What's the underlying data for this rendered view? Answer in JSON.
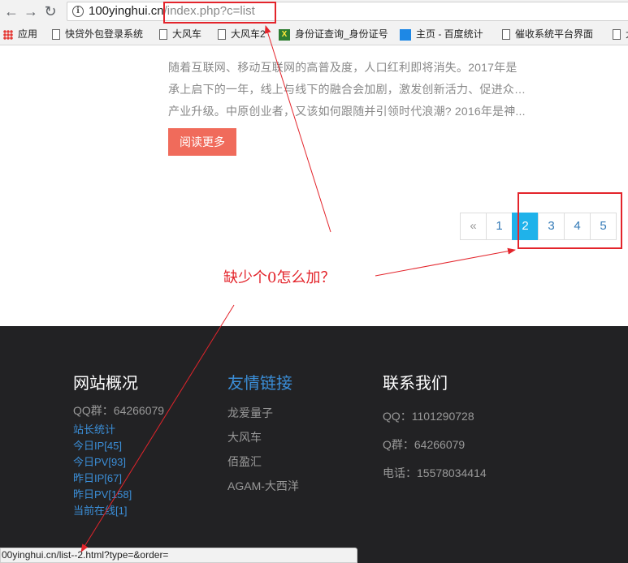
{
  "browser": {
    "url_host": "100yinghui.cn",
    "url_path": "/index.php?c=list",
    "bookmarks": [
      {
        "label": "应用",
        "icon": "apps-icon"
      },
      {
        "label": "快贷外包登录系统",
        "icon": "page-icon"
      },
      {
        "label": "大风车",
        "icon": "page-icon"
      },
      {
        "label": "大风车2",
        "icon": "page-icon"
      },
      {
        "label": "身份证查询_身份证号",
        "icon": "id-card-icon"
      },
      {
        "label": "主页 - 百度统计",
        "icon": "chart-icon"
      },
      {
        "label": "催收系统平台界面",
        "icon": "page-icon"
      },
      {
        "label": "大",
        "icon": "page-icon"
      }
    ]
  },
  "article": {
    "excerpt_lines": [
      "随着互联网、移动互联网的高普及度，人口红利即将消失。2017年是",
      "承上启下的一年，线上与线下的融合会加剧，激发创新活力、促进众多",
      "产业升级。中原创业者，又该如何跟随并引领时代浪潮? 2016年是神..."
    ],
    "read_more": "阅读更多"
  },
  "pagination": {
    "prev": "«",
    "pages": [
      "1",
      "2",
      "3",
      "4",
      "5"
    ],
    "active_page": "2"
  },
  "annotation": {
    "text": "缺少个0怎么加？",
    "color": "#e3242b"
  },
  "footer": {
    "col1": {
      "title": "网站概况",
      "qq_group": "QQ群：64266079",
      "stats": [
        "站长统计",
        "今日IP[45]",
        "今日PV[93]",
        "昨日IP[67]",
        "昨日PV[158]",
        "当前在线[1]"
      ]
    },
    "col2": {
      "title": "友情链接",
      "links": [
        "龙爱量子",
        "大风车",
        "佰盈汇",
        "AGAM-大西洋"
      ]
    },
    "col3": {
      "title": "联系我们",
      "contact": [
        "QQ：1101290728",
        "Q群：64266079",
        "电话：15578034414"
      ]
    }
  },
  "status_bar": {
    "text": "00yinghui.cn/list--2.html?type=&order="
  },
  "colors": {
    "accent_blue": "#1fb2ea",
    "button_coral": "#f06b5b",
    "footer_bg": "#222224",
    "link_blue": "#3b8fd9"
  }
}
